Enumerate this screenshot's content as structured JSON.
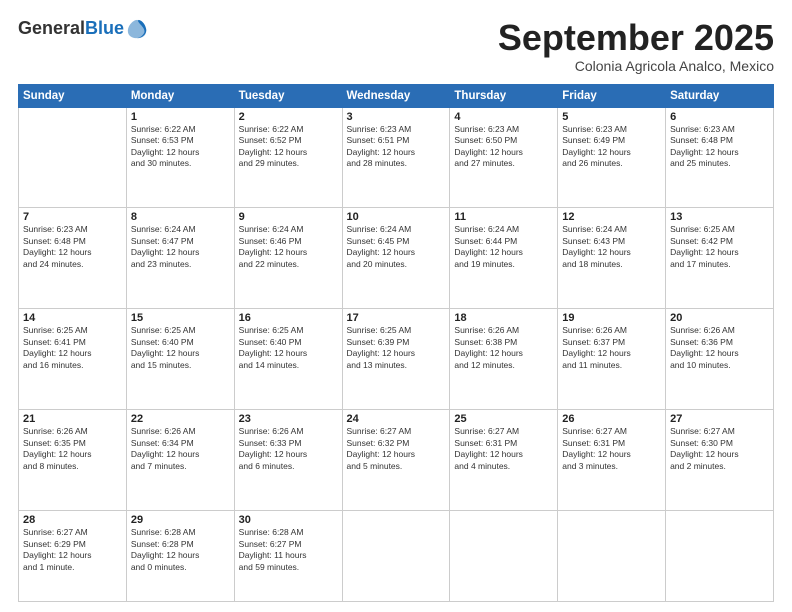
{
  "header": {
    "logo_general": "General",
    "logo_blue": "Blue",
    "month_title": "September 2025",
    "location": "Colonia Agricola Analco, Mexico"
  },
  "days_of_week": [
    "Sunday",
    "Monday",
    "Tuesday",
    "Wednesday",
    "Thursday",
    "Friday",
    "Saturday"
  ],
  "weeks": [
    [
      {
        "day": "",
        "info": ""
      },
      {
        "day": "1",
        "info": "Sunrise: 6:22 AM\nSunset: 6:53 PM\nDaylight: 12 hours\nand 30 minutes."
      },
      {
        "day": "2",
        "info": "Sunrise: 6:22 AM\nSunset: 6:52 PM\nDaylight: 12 hours\nand 29 minutes."
      },
      {
        "day": "3",
        "info": "Sunrise: 6:23 AM\nSunset: 6:51 PM\nDaylight: 12 hours\nand 28 minutes."
      },
      {
        "day": "4",
        "info": "Sunrise: 6:23 AM\nSunset: 6:50 PM\nDaylight: 12 hours\nand 27 minutes."
      },
      {
        "day": "5",
        "info": "Sunrise: 6:23 AM\nSunset: 6:49 PM\nDaylight: 12 hours\nand 26 minutes."
      },
      {
        "day": "6",
        "info": "Sunrise: 6:23 AM\nSunset: 6:48 PM\nDaylight: 12 hours\nand 25 minutes."
      }
    ],
    [
      {
        "day": "7",
        "info": "Sunrise: 6:23 AM\nSunset: 6:48 PM\nDaylight: 12 hours\nand 24 minutes."
      },
      {
        "day": "8",
        "info": "Sunrise: 6:24 AM\nSunset: 6:47 PM\nDaylight: 12 hours\nand 23 minutes."
      },
      {
        "day": "9",
        "info": "Sunrise: 6:24 AM\nSunset: 6:46 PM\nDaylight: 12 hours\nand 22 minutes."
      },
      {
        "day": "10",
        "info": "Sunrise: 6:24 AM\nSunset: 6:45 PM\nDaylight: 12 hours\nand 20 minutes."
      },
      {
        "day": "11",
        "info": "Sunrise: 6:24 AM\nSunset: 6:44 PM\nDaylight: 12 hours\nand 19 minutes."
      },
      {
        "day": "12",
        "info": "Sunrise: 6:24 AM\nSunset: 6:43 PM\nDaylight: 12 hours\nand 18 minutes."
      },
      {
        "day": "13",
        "info": "Sunrise: 6:25 AM\nSunset: 6:42 PM\nDaylight: 12 hours\nand 17 minutes."
      }
    ],
    [
      {
        "day": "14",
        "info": "Sunrise: 6:25 AM\nSunset: 6:41 PM\nDaylight: 12 hours\nand 16 minutes."
      },
      {
        "day": "15",
        "info": "Sunrise: 6:25 AM\nSunset: 6:40 PM\nDaylight: 12 hours\nand 15 minutes."
      },
      {
        "day": "16",
        "info": "Sunrise: 6:25 AM\nSunset: 6:40 PM\nDaylight: 12 hours\nand 14 minutes."
      },
      {
        "day": "17",
        "info": "Sunrise: 6:25 AM\nSunset: 6:39 PM\nDaylight: 12 hours\nand 13 minutes."
      },
      {
        "day": "18",
        "info": "Sunrise: 6:26 AM\nSunset: 6:38 PM\nDaylight: 12 hours\nand 12 minutes."
      },
      {
        "day": "19",
        "info": "Sunrise: 6:26 AM\nSunset: 6:37 PM\nDaylight: 12 hours\nand 11 minutes."
      },
      {
        "day": "20",
        "info": "Sunrise: 6:26 AM\nSunset: 6:36 PM\nDaylight: 12 hours\nand 10 minutes."
      }
    ],
    [
      {
        "day": "21",
        "info": "Sunrise: 6:26 AM\nSunset: 6:35 PM\nDaylight: 12 hours\nand 8 minutes."
      },
      {
        "day": "22",
        "info": "Sunrise: 6:26 AM\nSunset: 6:34 PM\nDaylight: 12 hours\nand 7 minutes."
      },
      {
        "day": "23",
        "info": "Sunrise: 6:26 AM\nSunset: 6:33 PM\nDaylight: 12 hours\nand 6 minutes."
      },
      {
        "day": "24",
        "info": "Sunrise: 6:27 AM\nSunset: 6:32 PM\nDaylight: 12 hours\nand 5 minutes."
      },
      {
        "day": "25",
        "info": "Sunrise: 6:27 AM\nSunset: 6:31 PM\nDaylight: 12 hours\nand 4 minutes."
      },
      {
        "day": "26",
        "info": "Sunrise: 6:27 AM\nSunset: 6:31 PM\nDaylight: 12 hours\nand 3 minutes."
      },
      {
        "day": "27",
        "info": "Sunrise: 6:27 AM\nSunset: 6:30 PM\nDaylight: 12 hours\nand 2 minutes."
      }
    ],
    [
      {
        "day": "28",
        "info": "Sunrise: 6:27 AM\nSunset: 6:29 PM\nDaylight: 12 hours\nand 1 minute."
      },
      {
        "day": "29",
        "info": "Sunrise: 6:28 AM\nSunset: 6:28 PM\nDaylight: 12 hours\nand 0 minutes."
      },
      {
        "day": "30",
        "info": "Sunrise: 6:28 AM\nSunset: 6:27 PM\nDaylight: 11 hours\nand 59 minutes."
      },
      {
        "day": "",
        "info": ""
      },
      {
        "day": "",
        "info": ""
      },
      {
        "day": "",
        "info": ""
      },
      {
        "day": "",
        "info": ""
      }
    ]
  ]
}
